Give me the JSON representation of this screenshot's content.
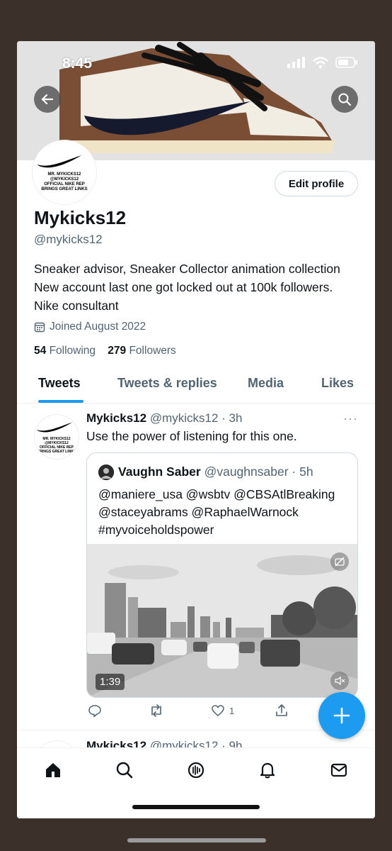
{
  "status": {
    "time": "8:45"
  },
  "header": {
    "back_icon": "arrow-left-icon",
    "search_icon": "search-icon"
  },
  "profile": {
    "avatar_text_line1": "MR. MYKICKS12 @MYKICKS12",
    "avatar_text_line2": "OFFICIAL NIKE REP",
    "avatar_text_line3": "BRINGS GREAT LINKS",
    "edit_label": "Edit profile",
    "name": "Mykicks12",
    "handle": "@mykicks12",
    "bio": "Sneaker advisor, Sneaker Collector animation collection New account last one got locked out at 100k followers. Nike consultant",
    "joined": "Joined August 2022",
    "following_count": "54",
    "following_label": "Following",
    "followers_count": "279",
    "followers_label": "Followers"
  },
  "tabs": [
    "Tweets",
    "Tweets & replies",
    "Media",
    "Likes"
  ],
  "tweet": {
    "name": "Mykicks12",
    "meta": "@mykicks12 · 3h",
    "text": "Use the power of listening for this one.",
    "more": "···",
    "quote": {
      "name": "Vaughn Saber",
      "meta": "@vaughnsaber · 5h",
      "lines": [
        "@maniere_usa @wsbtv @CBSAtlBreaking",
        "@staceyabrams @RaphaelWarnock",
        "#myvoiceholdspower"
      ],
      "duration": "1:39"
    },
    "actions": {
      "likes": "1"
    }
  },
  "next_tweet": {
    "name": "Mykicks12",
    "meta": "@mykicks12 · 9h"
  },
  "colors": {
    "accent": "#1d9bf0",
    "text": "#0f1419",
    "muted": "#536471"
  }
}
